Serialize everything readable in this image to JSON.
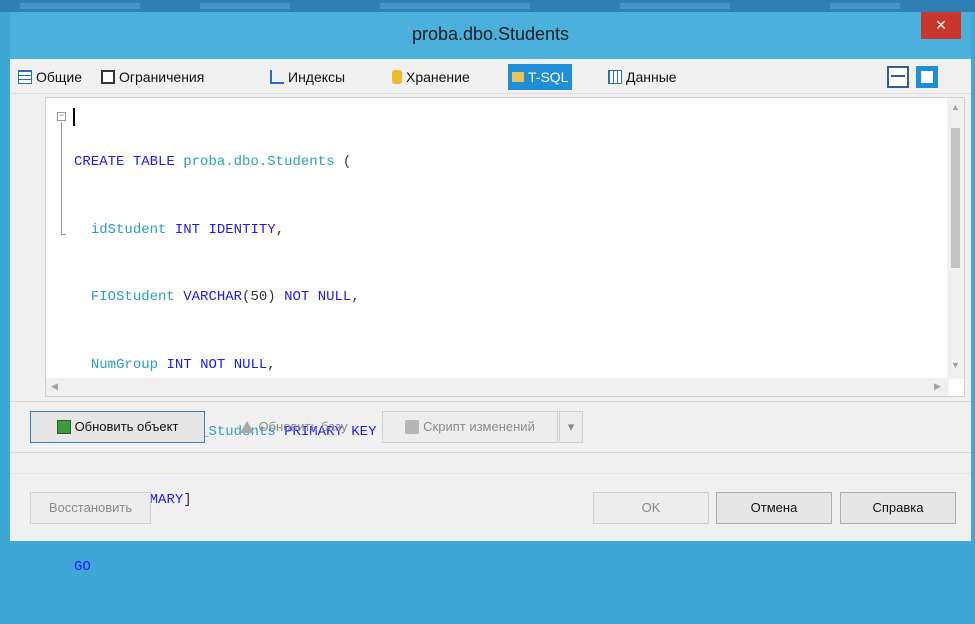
{
  "window": {
    "title": "proba.dbo.Students",
    "close_label": "×"
  },
  "tabs": [
    {
      "label": "Общие",
      "icon": "general-grid-icon"
    },
    {
      "label": "Ограничения",
      "icon": "constraints-icon"
    },
    {
      "label": "Индексы",
      "icon": "indexes-tree-icon"
    },
    {
      "label": "Хранение",
      "icon": "storage-cylinder-icon"
    },
    {
      "label": "T-SQL",
      "icon": "tsql-script-icon",
      "active": true
    },
    {
      "label": "Данные",
      "icon": "data-table-icon"
    }
  ],
  "editor": {
    "lines": [
      "CREATE TABLE proba.dbo.Students (",
      "  idStudent INT IDENTITY,",
      "  FIOStudent VARCHAR(50) NOT NULL,",
      "  NumGroup INT NOT NULL,",
      "  CONSTRAINT PK_Students PRIMARY KEY (idStudent)",
      ") ON [PRIMARY]",
      "GO"
    ]
  },
  "actions": {
    "refresh_object": "Обновить объект",
    "refresh_db": "Обновить базу",
    "change_script": "Скрипт изменений"
  },
  "footer": {
    "restore": "Восстановить",
    "ok": "OK",
    "cancel": "Отмена",
    "help": "Справка"
  },
  "colors": {
    "title_bar": "#4cb0dc",
    "active_tab": "#1e8fd6",
    "keyword": "#1a1aff",
    "identifier": "#2aa0b5"
  }
}
